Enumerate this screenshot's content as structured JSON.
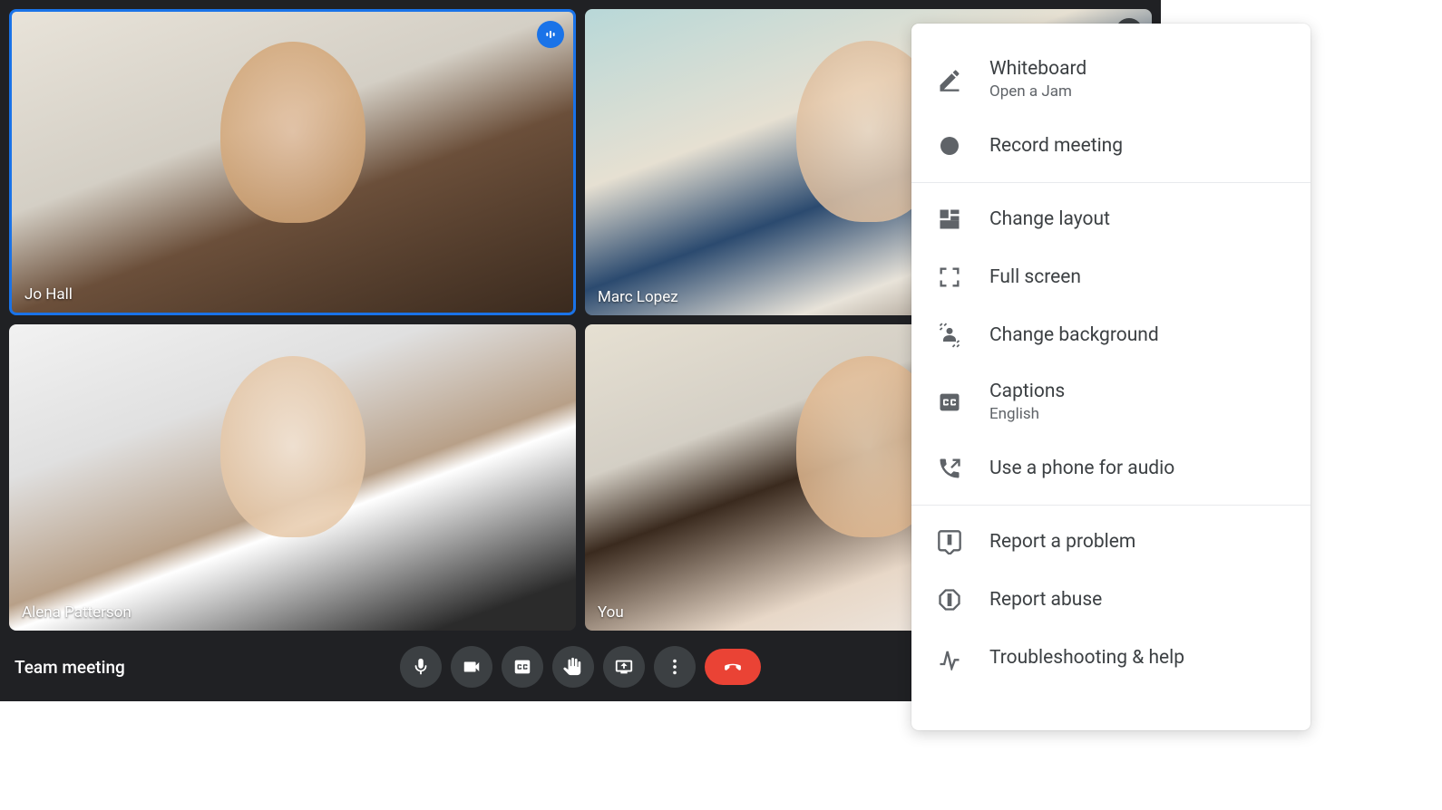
{
  "meeting": {
    "name": "Team meeting"
  },
  "participants": [
    {
      "name": "Jo Hall",
      "speaking": true,
      "muted": false
    },
    {
      "name": "Marc Lopez",
      "speaking": false,
      "muted": true
    },
    {
      "name": "Alena Patterson",
      "speaking": false,
      "muted": false
    },
    {
      "name": "You",
      "speaking": false,
      "muted": false
    }
  ],
  "menu": {
    "whiteboard": {
      "title": "Whiteboard",
      "subtitle": "Open a Jam"
    },
    "record": "Record meeting",
    "layout": "Change layout",
    "fullscreen": "Full screen",
    "background": "Change background",
    "captions": {
      "title": "Captions",
      "subtitle": "English"
    },
    "phone": "Use a phone for audio",
    "report_problem": "Report a problem",
    "report_abuse": "Report abuse",
    "troubleshoot": "Troubleshooting & help"
  }
}
